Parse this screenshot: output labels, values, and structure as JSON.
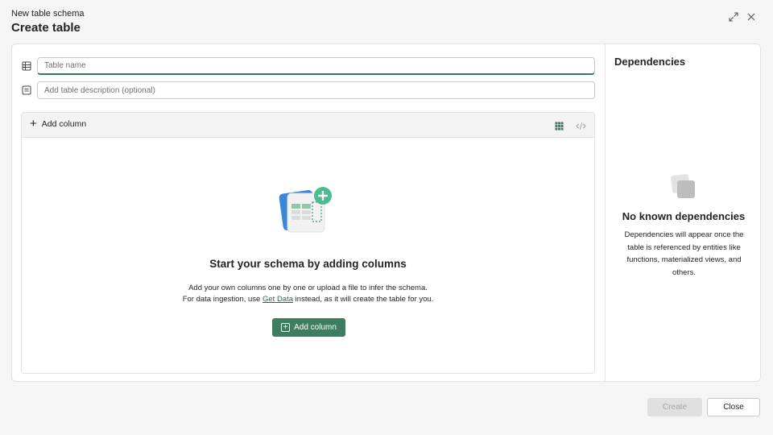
{
  "header": {
    "subtitle": "New table schema",
    "title": "Create table",
    "expand_icon": "expand-icon",
    "close_icon": "close-icon"
  },
  "form": {
    "table_name_placeholder": "Table name",
    "table_name_value": "",
    "description_placeholder": "Add table description (optional)",
    "description_value": ""
  },
  "columns": {
    "add_column_label": "Add column",
    "grid_view_icon": "grid-icon",
    "code_view_icon": "code-icon"
  },
  "empty_state": {
    "title": "Start your schema by adding columns",
    "line1": "Add your own columns one by one or upload a file to infer the schema.",
    "line2_prefix": "For data ingestion, use ",
    "link_text": "Get Data",
    "line2_suffix": " instead, as it will create the table for you.",
    "button_label": "Add column"
  },
  "dependencies": {
    "title": "Dependencies",
    "empty_title": "No known dependencies",
    "empty_desc": "Dependencies will appear once the table is referenced by entities like functions, materialized views, and others."
  },
  "footer": {
    "create_label": "Create",
    "close_label": "Close"
  },
  "colors": {
    "accent": "#3f7d60",
    "link": "#1e6b4a",
    "disabled_bg": "#e0e0e0"
  }
}
